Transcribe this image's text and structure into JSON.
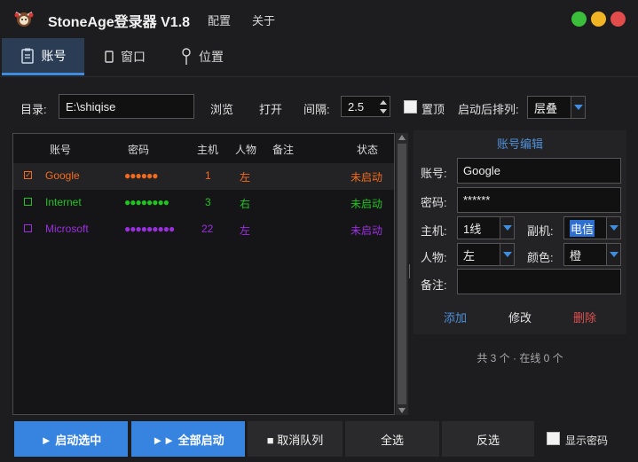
{
  "app": {
    "title": "StoneAge登录器  V1.8"
  },
  "menu": [
    "配置",
    "关于"
  ],
  "window_buttons": {
    "minimize_color": "#3bbf3b",
    "maximize_color": "#f0b424",
    "close_color": "#e24c4b"
  },
  "tabs": [
    {
      "label": "账号",
      "icon": "document-icon",
      "active": true
    },
    {
      "label": "窗口",
      "icon": "window-icon",
      "active": false
    },
    {
      "label": "位置",
      "icon": "pin-icon",
      "active": false
    }
  ],
  "toolbar": {
    "dir_label": "目录:",
    "dir_value": "E:\\shiqise",
    "browse": "浏览",
    "open": "打开",
    "interval_label": "间隔:",
    "interval_value": "2.5",
    "pin_top_label": "置顶",
    "arrange_label": "启动后排列:",
    "arrange_value": "层叠"
  },
  "table": {
    "columns": [
      "账号",
      "密码",
      "主机",
      "人物",
      "备注",
      "状态"
    ],
    "rows": [
      {
        "account": "Google",
        "password": "●●●●●●",
        "host": "1",
        "char": "左",
        "note": "",
        "status": "未启动",
        "color": "#f26b1d",
        "checked": true
      },
      {
        "account": "Internet",
        "password": "●●●●●●●●",
        "host": "3",
        "char": "右",
        "note": "",
        "status": "未启动",
        "color": "#21c321",
        "checked": false
      },
      {
        "account": "Microsoft",
        "password": "●●●●●●●●●",
        "host": "22",
        "char": "左",
        "note": "",
        "status": "未启动",
        "color": "#9b2fe0",
        "checked": false
      }
    ]
  },
  "editor": {
    "title": "账号编辑",
    "account_label": "账号:",
    "account_value": "Google",
    "password_label": "密码:",
    "password_value": "******",
    "host_label": "主机:",
    "host_value": "1线",
    "subhost_label": "副机:",
    "subhost_value": "电信",
    "char_label": "人物:",
    "char_value": "左",
    "color_label": "颜色:",
    "color_value": "橙",
    "note_label": "备注:",
    "note_value": "",
    "add": "添加",
    "modify": "修改",
    "delete": "删除"
  },
  "summary": "共 3 个 · 在线 0 个",
  "bottom": {
    "start_selected": "► 启动选中",
    "start_all": "►► 全部启动",
    "cancel_queue": "■ 取消队列",
    "select_all": "全选",
    "invert": "反选",
    "show_password": "显示密码"
  },
  "colors": {
    "accent": "#3784e0",
    "link": "#4f8fd8",
    "danger": "#e05050"
  }
}
